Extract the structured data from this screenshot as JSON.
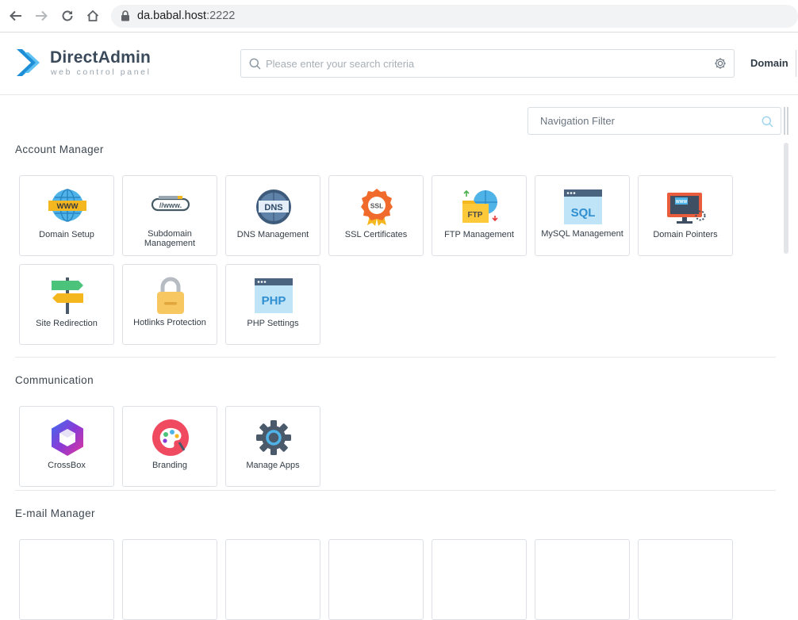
{
  "browser": {
    "url_host": "da.babal.host",
    "url_port": ":2222"
  },
  "header": {
    "logo_title": "DirectAdmin",
    "logo_subtitle": "web control panel",
    "search_placeholder": "Please enter your search criteria",
    "domain_label": "Domain"
  },
  "nav_filter": {
    "placeholder": "Navigation Filter"
  },
  "sections": {
    "account_manager": {
      "title": "Account Manager",
      "tiles": [
        {
          "label": "Domain Setup",
          "icon": "globe-www-icon"
        },
        {
          "label": "Subdomain Management",
          "icon": "subdomain-www-icon"
        },
        {
          "label": "DNS Management",
          "icon": "dns-globe-icon"
        },
        {
          "label": "SSL Certificates",
          "icon": "ssl-badge-icon"
        },
        {
          "label": "FTP Management",
          "icon": "ftp-folder-icon"
        },
        {
          "label": "MySQL Management",
          "icon": "sql-window-icon"
        },
        {
          "label": "Domain Pointers",
          "icon": "monitor-www-icon"
        },
        {
          "label": "Site Redirection",
          "icon": "signpost-icon"
        },
        {
          "label": "Hotlinks Protection",
          "icon": "padlock-icon"
        },
        {
          "label": "PHP Settings",
          "icon": "php-window-icon"
        }
      ]
    },
    "communication": {
      "title": "Communication",
      "tiles": [
        {
          "label": "CrossBox",
          "icon": "crossbox-hexagon-icon"
        },
        {
          "label": "Branding",
          "icon": "paint-palette-icon"
        },
        {
          "label": "Manage Apps",
          "icon": "gear-apps-icon"
        }
      ]
    },
    "email_manager": {
      "title": "E-mail Manager"
    }
  },
  "colors": {
    "brand_blue": "#1e8fd6",
    "tile_border": "#dde1e5"
  }
}
